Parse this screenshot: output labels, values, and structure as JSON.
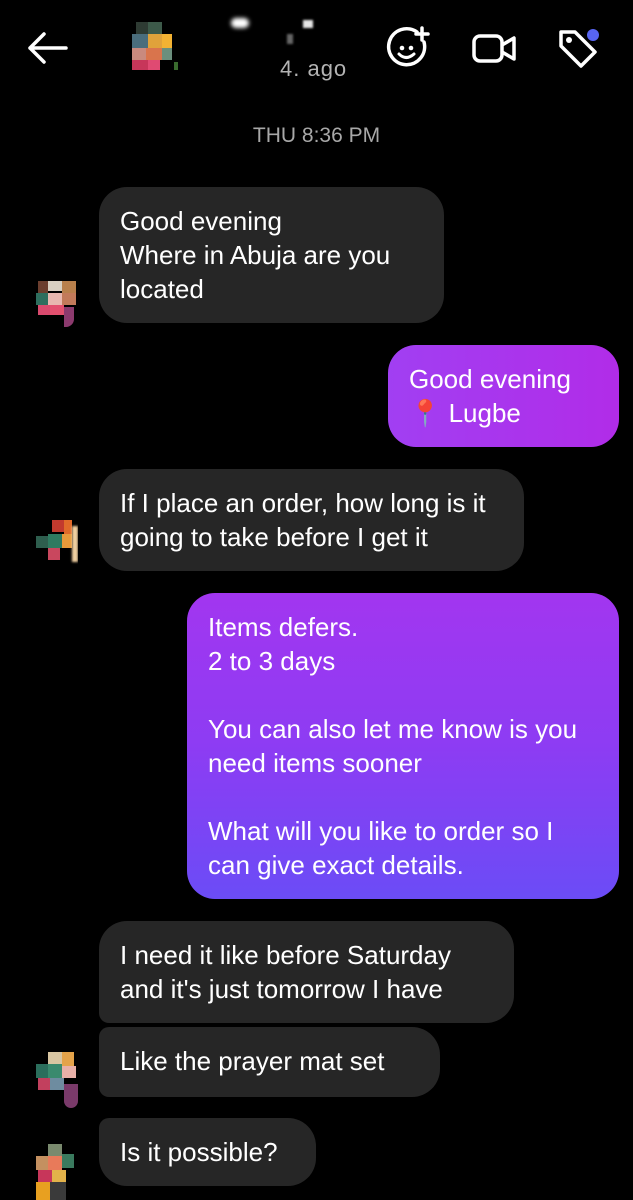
{
  "header": {
    "status_text": "4. ago",
    "icons": [
      "back-arrow-icon",
      "add-effect-icon",
      "video-call-icon",
      "tag-icon"
    ],
    "badge_color": "#5865f2"
  },
  "thread": {
    "timestamp": "THU 8:36 PM"
  },
  "messages": [
    {
      "from": "them",
      "text": "Good evening\nWhere in Abuja are you located"
    },
    {
      "from": "me",
      "text": "Good evening\n📍 Lugbe"
    },
    {
      "from": "them",
      "text": "If I place an order, how long is it going to take before I get it"
    },
    {
      "from": "me",
      "text": "Items defers.\n2 to 3 days\n\nYou can also let me know is you need items sooner\n\nWhat will you like to order so I can give exact details."
    },
    {
      "from": "them",
      "text": "I need it like before Saturday and it's just tomorrow I have"
    },
    {
      "from": "them",
      "text": "Like the prayer mat set"
    },
    {
      "from": "them",
      "text": "Is it possible?"
    }
  ],
  "colors": {
    "background": "#000000",
    "received_bubble": "#262626",
    "sent_gradient_top": "#a236f0",
    "sent_gradient_bottom": "#6b4cf6",
    "timestamp": "#a8a8a8"
  }
}
